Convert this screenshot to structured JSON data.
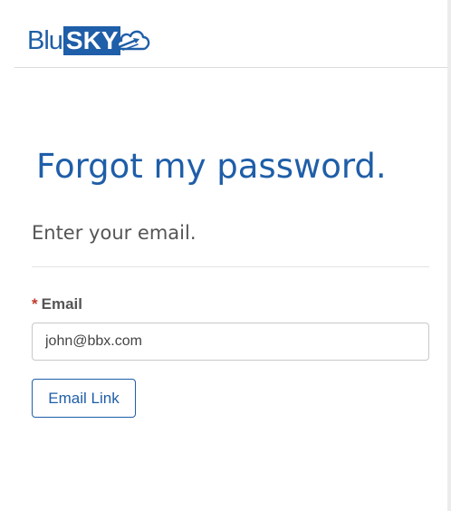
{
  "brand": {
    "logo_part1": "Blu",
    "logo_part2": "SKY",
    "color": "#1f5ea8"
  },
  "page": {
    "title": "Forgot my password.",
    "subtitle": "Enter your email."
  },
  "form": {
    "email_label": "Email",
    "required_marker": "*",
    "email_value": "john@bbx.com",
    "submit_label": "Email Link"
  },
  "icons": {
    "logo_cloud": "cloud-arrow-icon"
  }
}
